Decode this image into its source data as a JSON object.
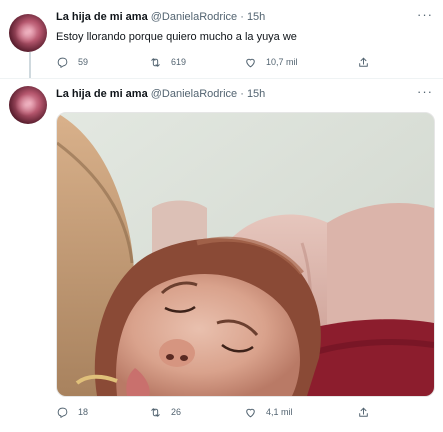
{
  "tweets": [
    {
      "display_name": "La hija de mi ama",
      "handle": "@DanielaRodrice",
      "separator": "·",
      "time": "15h",
      "text": "Estoy llorando porque quiero mucho a la yuya we",
      "replies": "59",
      "retweets": "619",
      "likes": "10,7 mil"
    },
    {
      "display_name": "La hija de mi ama",
      "handle": "@DanielaRodrice",
      "separator": "·",
      "time": "15h",
      "replies": "18",
      "retweets": "26",
      "likes": "4,1 mil"
    }
  ],
  "more_menu_glyph": "···",
  "icons": [
    "reply-icon",
    "retweet-icon",
    "like-icon",
    "share-icon",
    "more-icon"
  ]
}
